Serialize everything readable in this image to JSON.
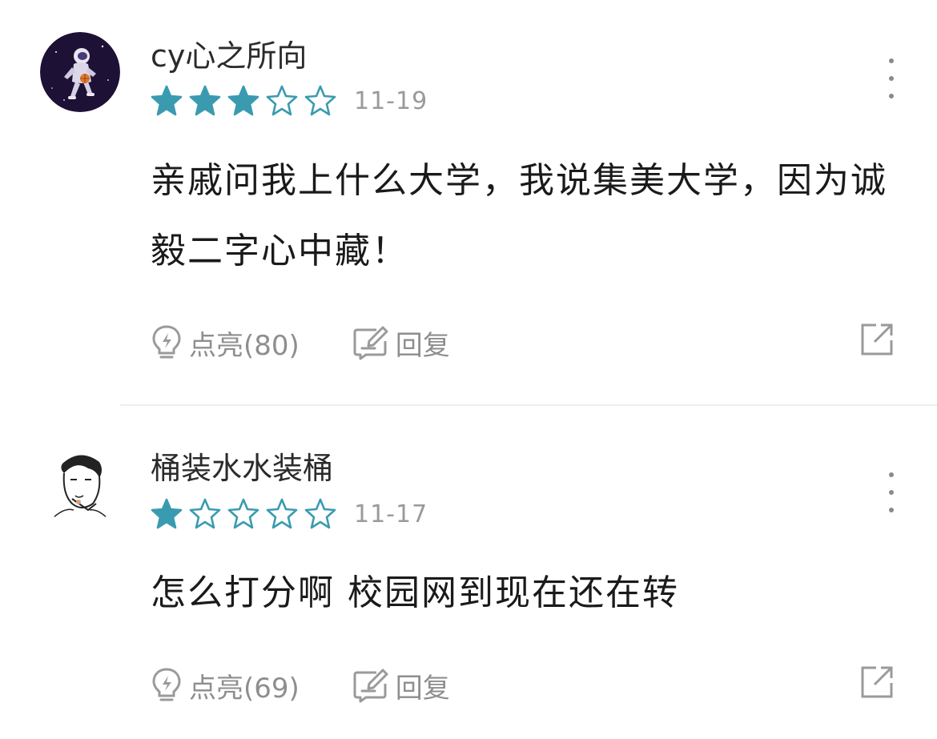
{
  "comments": [
    {
      "username": "cy心之所向",
      "rating": 3,
      "max_rating": 5,
      "date": "11-19",
      "text": "亲戚问我上什么大学，我说集美大学，因为诚毅二字心中藏！",
      "like_label": "点亮(80)",
      "reply_label": "回复"
    },
    {
      "username": "桶装水水装桶",
      "rating": 1,
      "max_rating": 5,
      "date": "11-17",
      "text": "怎么打分啊 校园网到现在还在转",
      "like_label": "点亮(69)",
      "reply_label": "回复"
    }
  ],
  "colors": {
    "star": "#3a9bb0",
    "muted": "#8e8e8e",
    "divider": "#eeeeee"
  },
  "icons": {
    "like": "lightbulb-icon",
    "reply": "edit-reply-icon",
    "share": "share-icon",
    "more": "more-vertical-icon"
  }
}
